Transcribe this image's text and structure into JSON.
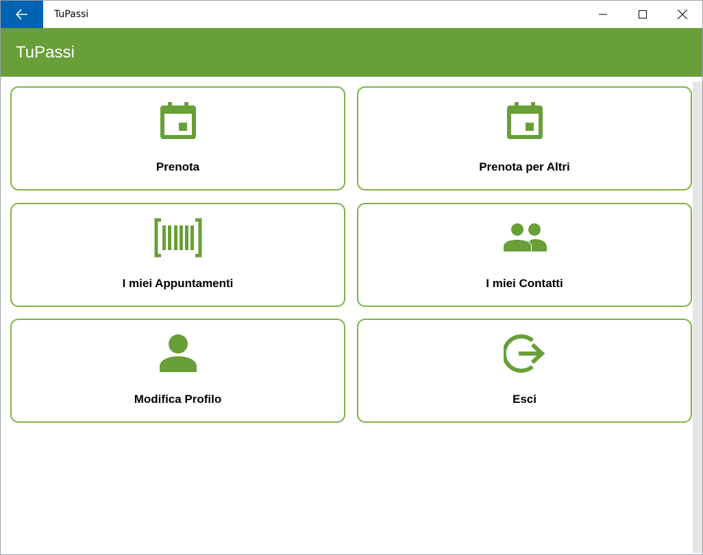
{
  "window": {
    "title": "TuPassi",
    "back_icon": "arrow-left-icon",
    "controls": [
      "minimize-icon",
      "maximize-icon",
      "close-icon"
    ]
  },
  "header": {
    "title": "TuPassi"
  },
  "colors": {
    "accent": "#689f38",
    "tile_border": "#7cb342",
    "back_button": "#0063b1"
  },
  "menu": {
    "items": [
      {
        "label": "Prenota",
        "icon": "calendar-icon"
      },
      {
        "label": "Prenota per Altri",
        "icon": "calendar-icon"
      },
      {
        "label": "I miei Appuntamenti",
        "icon": "barcode-icon"
      },
      {
        "label": "I miei Contatti",
        "icon": "people-icon"
      },
      {
        "label": "Modifica Profilo",
        "icon": "person-icon"
      },
      {
        "label": "Esci",
        "icon": "logout-icon"
      }
    ]
  }
}
